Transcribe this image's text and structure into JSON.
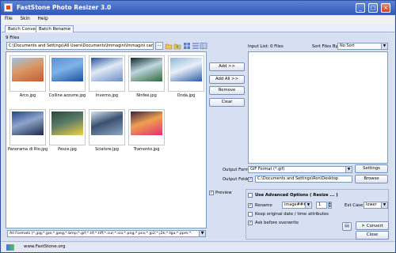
{
  "window": {
    "title": "FastStone Photo Resizer 3.0"
  },
  "menu": [
    "File",
    "Skin",
    "Help"
  ],
  "tabs": [
    "Batch Convert",
    "Batch Rename"
  ],
  "files": {
    "count_label": "9 Files",
    "path": "C:\\Documents and Settings\\All Users\\Documents\\Immagini\\Immagini campione\\",
    "items": [
      {
        "name": "Arco.jpg",
        "palette": [
          "#9fc4e6",
          "#c75d32",
          "#d99968"
        ]
      },
      {
        "name": "Colline azzurre.jpg",
        "palette": [
          "#5d8fd7",
          "#1d4fa4",
          "#7eb3e6"
        ]
      },
      {
        "name": "Inverno.jpg",
        "palette": [
          "#27519c",
          "#6b8cc5",
          "#e1ebf6"
        ]
      },
      {
        "name": "Ninfee.jpg",
        "palette": [
          "#0a2a2a",
          "#2e6a3a",
          "#c0d6e0"
        ]
      },
      {
        "name": "Onda.jpg",
        "palette": [
          "#8fb7d6",
          "#2c5da8",
          "#e8f0f7"
        ]
      },
      {
        "name": "Panorama di Rio.jpg",
        "palette": [
          "#26428b",
          "#1a2a44",
          "#8fa5cc"
        ]
      },
      {
        "name": "Pesce.jpg",
        "palette": [
          "#2a4a3a",
          "#f0d040",
          "#5a7a6a"
        ]
      },
      {
        "name": "Sciatore.jpg",
        "palette": [
          "#d4e2f0",
          "#8fa7c4",
          "#3a5070"
        ]
      },
      {
        "name": "Tramonto.jpg",
        "palette": [
          "#3a2040",
          "#e03070",
          "#f0a050"
        ]
      }
    ],
    "filter": "All Formats (*.jpg;*.jpe;*.jpeg;*.bmp;*.gif;*.tif;*.tiff;*.cur;*.ico;*.png;*.pcx;*.jp2;*.j2k;*.tga;*.ppm;*."
  },
  "buttons": {
    "add": "Add >>",
    "add_all": "Add All >>",
    "remove": "Remove",
    "clear": "Clear",
    "settings": "Settings",
    "browse": "Browse",
    "convert": "Convert",
    "close": "Close"
  },
  "input_list": {
    "label": "Input List:  0 Files"
  },
  "sort": {
    "label": "Sort Files By:",
    "value": "No Sort"
  },
  "output": {
    "format_label": "Output Format:",
    "format_value": "GIF Format (*.gif)",
    "folder_label": "Output Folder:",
    "folder_value": "C:\\Documents and Settings\\Ron\\Desktop"
  },
  "preview": {
    "label": "Preview",
    "checked": true
  },
  "advanced": {
    "label": "Use Advanced Options ( Resize ... )",
    "checked": false
  },
  "rename": {
    "label": "Rename",
    "checked": true,
    "pattern": "image####",
    "start": "1",
    "ext_case_label": "Ext Case:",
    "ext_case_value": "lower"
  },
  "keep_date": {
    "label": "Keep original date / time attributes",
    "checked": false
  },
  "ask_overwrite": {
    "label": "Ask before overwrite",
    "checked": true
  },
  "status": {
    "website": "www.FastStone.org"
  },
  "colors": {
    "titlebar": "#3d66c4",
    "panel": "#d7e0f2",
    "accent": "#3a9b3a"
  }
}
